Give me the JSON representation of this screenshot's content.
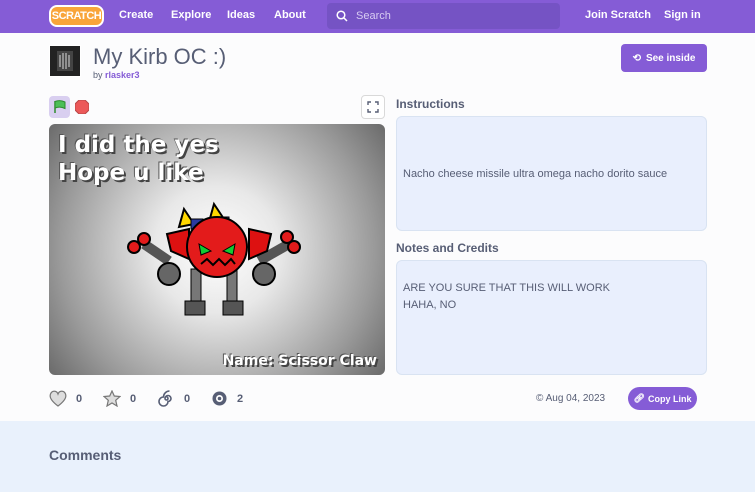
{
  "nav": {
    "logo": "SCRATCH",
    "create": "Create",
    "explore": "Explore",
    "ideas": "Ideas",
    "about": "About",
    "search_placeholder": "Search",
    "join": "Join Scratch",
    "signin": "Sign in"
  },
  "project": {
    "title": "My Kirb OC :)",
    "by": "by",
    "author": "rlasker3",
    "see_inside": "See inside"
  },
  "stage": {
    "line1": "I did the yes",
    "line2": "Hope u like",
    "name_text": "Name: Scissor Claw"
  },
  "instructions": {
    "heading": "Instructions",
    "text": "Nacho cheese missile ultra omega nacho dorito sauce"
  },
  "notes": {
    "heading": "Notes and Credits",
    "line1": "ARE YOU SURE THAT THIS WILL WORK",
    "line2": "HAHA, NO"
  },
  "stats": {
    "loves": "0",
    "favorites": "0",
    "remixes": "0",
    "views": "2"
  },
  "date": "Aug 04, 2023",
  "copy_link": "Copy Link",
  "comments_heading": "Comments",
  "colors": {
    "brand": "#855cd6",
    "logo": "#f9a53a"
  }
}
